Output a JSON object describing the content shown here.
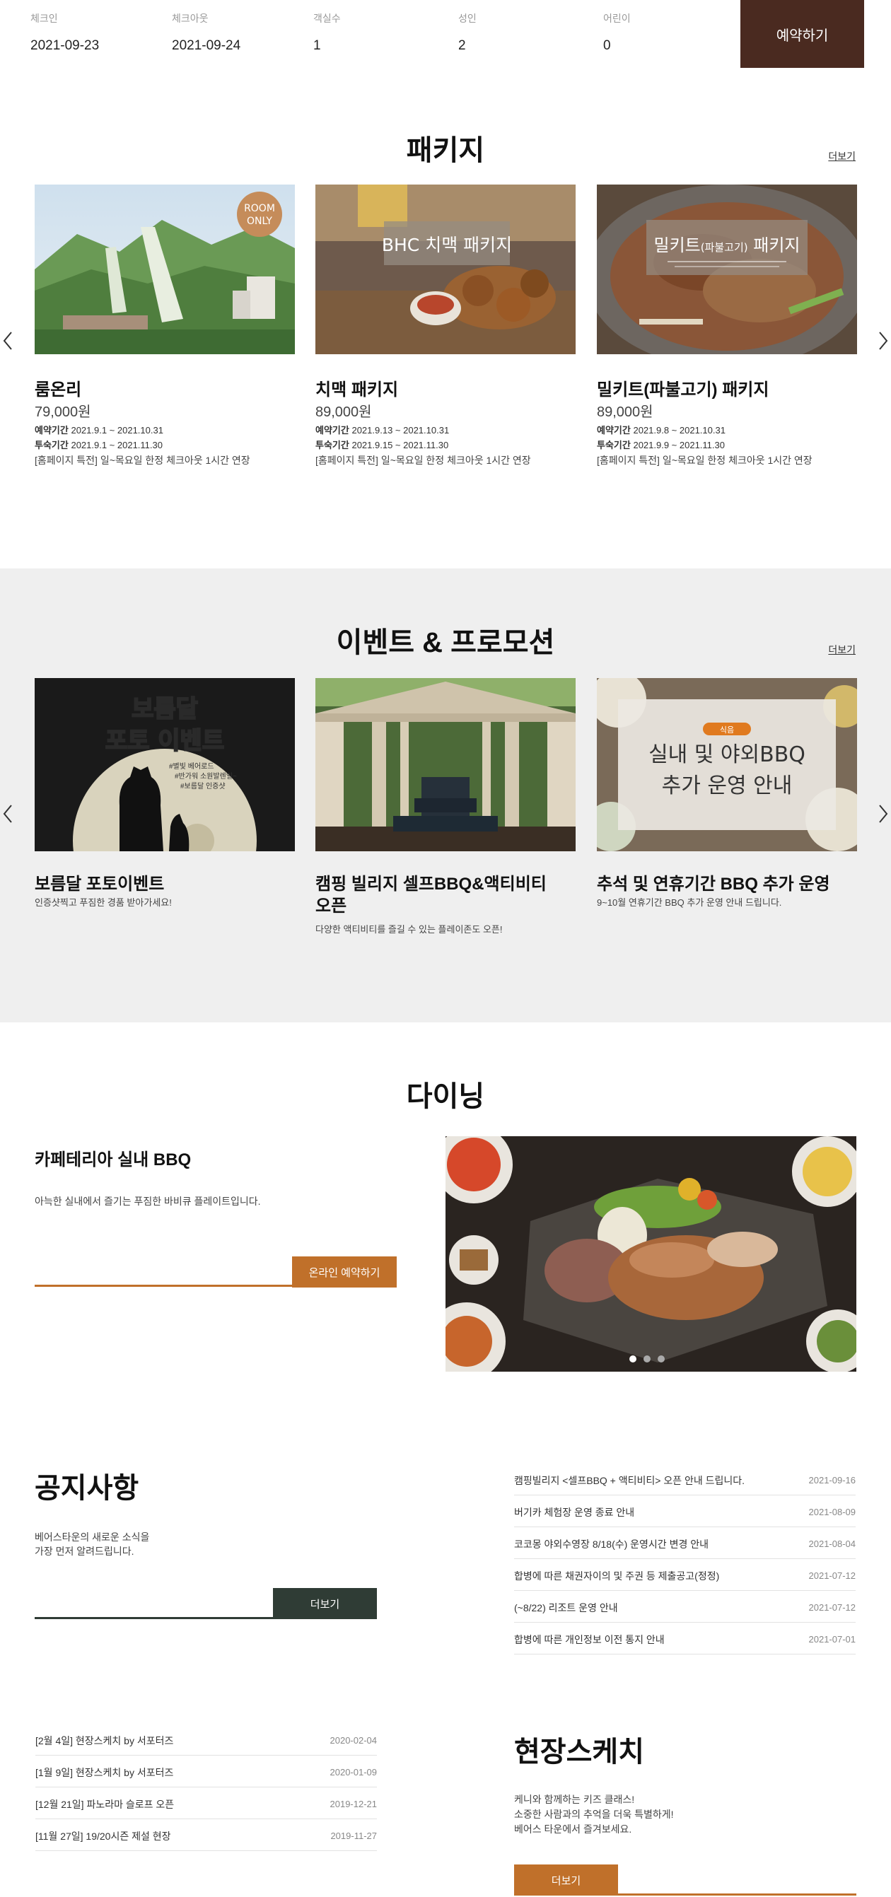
{
  "booking": {
    "checkin_label": "체크인",
    "checkin_value": "2021-09-23",
    "checkout_label": "체크아웃",
    "checkout_value": "2021-09-24",
    "rooms_label": "객실수",
    "rooms_value": "1",
    "adults_label": "성인",
    "adults_value": "2",
    "children_label": "어린이",
    "children_value": "0",
    "reserve_label": "예약하기"
  },
  "packages": {
    "title": "패키지",
    "more_label": "더보기",
    "items": [
      {
        "badge_line1": "ROOM",
        "badge_line2": "ONLY",
        "title": "룸온리",
        "price": "79,000원",
        "reserve_key": "예약기간",
        "reserve_val": "2021.9.1 ~ 2021.10.31",
        "stay_key": "투숙기간",
        "stay_val": "2021.9.1 ~ 2021.11.30",
        "note": "[홈페이지 특전] 일~목요일 한정 체크아웃 1시간 연장"
      },
      {
        "overlay": "BHC 치맥 패키지",
        "title": "치맥 패키지",
        "price": "89,000원",
        "reserve_key": "예약기간",
        "reserve_val": "2021.9.13 ~ 2021.10.31",
        "stay_key": "투숙기간",
        "stay_val": "2021.9.15 ~ 2021.11.30",
        "note": "[홈페이지 특전] 일~목요일 한정 체크아웃 1시간 연장"
      },
      {
        "overlay_pre": "밀키트",
        "overlay_mid": "(파불고기)",
        "overlay_post": " 패키지",
        "title": "밀키트(파불고기) 패키지",
        "price": "89,000원",
        "reserve_key": "예약기간",
        "reserve_val": "2021.9.8 ~ 2021.10.31",
        "stay_key": "투숙기간",
        "stay_val": "2021.9.9 ~ 2021.11.30",
        "note": "[홈페이지 특전] 일~목요일 한정 체크아웃 1시간 연장"
      }
    ]
  },
  "events": {
    "title": "이벤트 & 프로모션",
    "more_label": "더보기",
    "items": [
      {
        "poster_line1": "보름달",
        "poster_line2": "포토 이벤트",
        "poster_tags": [
          "#별빛 베어로드",
          "#반가워 소원발렌일~",
          "#보름달 인증샷"
        ],
        "title": "보름달 포토이벤트",
        "desc": "인증샷찍고 푸짐한 경품 받아가세요!"
      },
      {
        "title_line1": "캠핑 빌리지 셀프BBQ&액티비티",
        "title_line2": "오픈",
        "desc": "다양한 액티비티를 즐길 수 있는 플레이존도 오픈!"
      },
      {
        "tag": "식음",
        "overlay_line1": "실내 및 야외BBQ",
        "overlay_line2": "추가 운영 안내",
        "title": "추석 및 연휴기간 BBQ 추가 운영",
        "desc": "9~10월 연휴기간 BBQ 추가 운영 안내 드립니다."
      }
    ]
  },
  "dining": {
    "title": "다이닝",
    "subtitle": "카페테리아 실내 BBQ",
    "desc": "아늑한 실내에서 즐기는 푸짐한 바비큐 플레이트입니다.",
    "button": "온라인 예약하기"
  },
  "notice": {
    "title": "공지사항",
    "desc_line1": "베어스타운의 새로운 소식을",
    "desc_line2": "가장 먼저 알려드립니다.",
    "more_label": "더보기",
    "items": [
      {
        "text": "캠핑빌리지 <셀프BBQ + 액티비티> 오픈 안내 드립니다.",
        "date": "2021-09-16"
      },
      {
        "text": "버기카 체험장 운영 종료 안내",
        "date": "2021-08-09"
      },
      {
        "text": "코코몽 야외수영장 8/18(수) 운영시간 변경 안내",
        "date": "2021-08-04"
      },
      {
        "text": "합병에 따른 채권자이의 및 주권 등 제출공고(정정)",
        "date": "2021-07-12"
      },
      {
        "text": "(~8/22) 리조트 운영 안내",
        "date": "2021-07-12"
      },
      {
        "text": "합병에 따른 개인정보 이전 통지 안내",
        "date": "2021-07-01"
      }
    ]
  },
  "sketch": {
    "title": "현장스케치",
    "desc_line1": "케니와 함께하는 키즈 클래스!",
    "desc_line2": "소중한 사람과의 추억을 더욱 특별하게!",
    "desc_line3": "베어스 타운에서 즐겨보세요.",
    "more_label": "더보기",
    "items": [
      {
        "text": "[2월 4일] 현장스케치 by 서포터즈",
        "date": "2020-02-04"
      },
      {
        "text": "[1월 9일] 현장스케치 by 서포터즈",
        "date": "2020-01-09"
      },
      {
        "text": "[12월 21일] 파노라마 슬로프 오픈",
        "date": "2019-12-21"
      },
      {
        "text": "[11월 27일] 19/20시즌 제설 현장",
        "date": "2019-11-27"
      }
    ]
  },
  "colors": {
    "brown_dark": "#4a2a20",
    "orange": "#c0702a",
    "green_dark": "#2f3c35",
    "events_bg": "#efefef"
  },
  "icons": {
    "prev": "chevron-left-icon",
    "next": "chevron-right-icon"
  }
}
